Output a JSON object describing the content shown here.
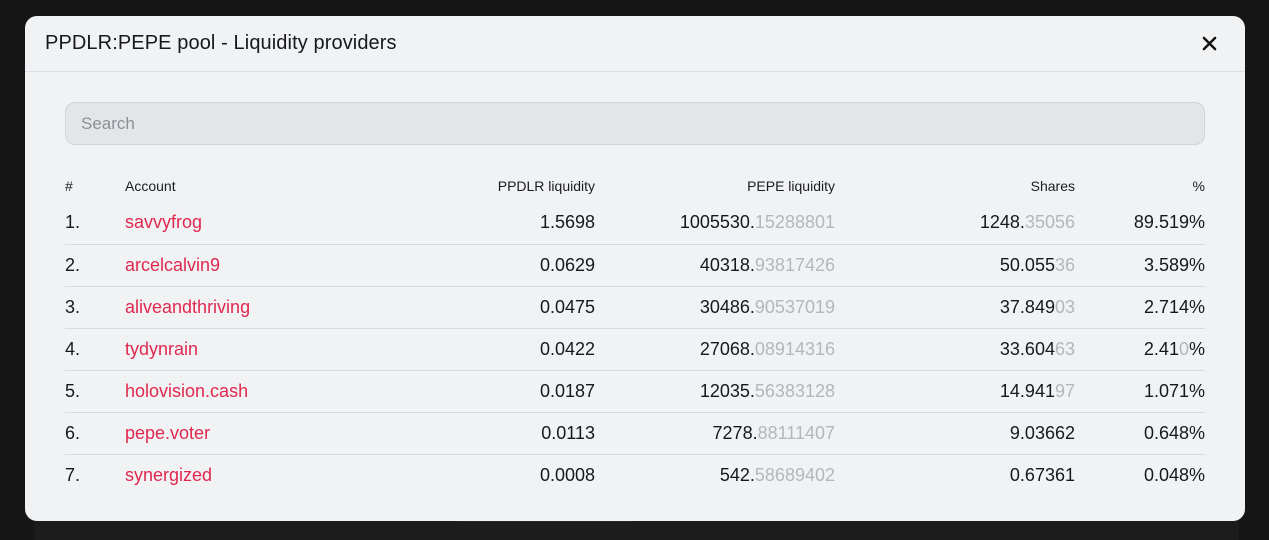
{
  "modal": {
    "title": "PPDLR:PEPE pool - Liquidity providers",
    "close_icon": "close-icon"
  },
  "search": {
    "placeholder": "Search",
    "value": ""
  },
  "table": {
    "headers": [
      "#",
      "Account",
      "PPDLR liquidity",
      "PEPE liquidity",
      "Shares",
      "%"
    ],
    "rows": [
      {
        "index": "1.",
        "account": "savvyfrog",
        "ppdlr": "1.5698",
        "pepe_main": "1005530.",
        "pepe_dim": "15288801",
        "shares_main": "1248.",
        "shares_dim": "35056",
        "pct_main": "89.519",
        "pct_dim": "",
        "pct_tail": "%"
      },
      {
        "index": "2.",
        "account": "arcelcalvin9",
        "ppdlr": "0.0629",
        "pepe_main": "40318.",
        "pepe_dim": "93817426",
        "shares_main": "50.055",
        "shares_dim": "36",
        "pct_main": "3.589",
        "pct_dim": "",
        "pct_tail": "%"
      },
      {
        "index": "3.",
        "account": "aliveandthriving",
        "ppdlr": "0.0475",
        "pepe_main": "30486.",
        "pepe_dim": "90537019",
        "shares_main": "37.849",
        "shares_dim": "03",
        "pct_main": "2.714",
        "pct_dim": "",
        "pct_tail": "%"
      },
      {
        "index": "4.",
        "account": "tydynrain",
        "ppdlr": "0.0422",
        "pepe_main": "27068.",
        "pepe_dim": "08914316",
        "shares_main": "33.604",
        "shares_dim": "63",
        "pct_main": "2.41",
        "pct_dim": "0",
        "pct_tail": "%"
      },
      {
        "index": "5.",
        "account": "holovision.cash",
        "ppdlr": "0.0187",
        "pepe_main": "12035.",
        "pepe_dim": "56383128",
        "shares_main": "14.941",
        "shares_dim": "97",
        "pct_main": "1.071",
        "pct_dim": "",
        "pct_tail": "%"
      },
      {
        "index": "6.",
        "account": "pepe.voter",
        "ppdlr": "0.0113",
        "pepe_main": "7278.",
        "pepe_dim": "88111407",
        "shares_main": "9.03662",
        "shares_dim": "",
        "pct_main": "0.648",
        "pct_dim": "",
        "pct_tail": "%"
      },
      {
        "index": "7.",
        "account": "synergized",
        "ppdlr": "0.0008",
        "pepe_main": "542.",
        "pepe_dim": "58689402",
        "shares_main": "0.67361",
        "shares_dim": "",
        "pct_main": "0.048",
        "pct_dim": "",
        "pct_tail": "%"
      }
    ]
  },
  "colors": {
    "accent_link": "#e0284f",
    "dim_digits": "#b3b7bd",
    "modal_bg": "#f1f2f4"
  }
}
